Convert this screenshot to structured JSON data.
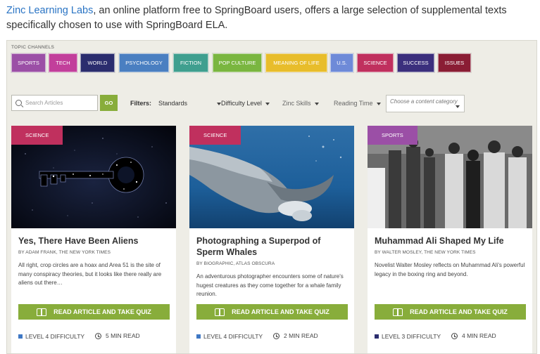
{
  "intro": {
    "link_text": "Zinc Learning Labs",
    "rest_text": ", an online platform free to SpringBoard users, offers a large selection of supplemental texts specifically chosen to use with SpringBoard ELA."
  },
  "channels": {
    "label": "TOPIC CHANNELS",
    "items": [
      {
        "label": "SPORTS",
        "color": "#9b4fa6"
      },
      {
        "label": "TECH",
        "color": "#c23f9b"
      },
      {
        "label": "WORLD",
        "color": "#2b2d6e"
      },
      {
        "label": "PSYCHOLOGY",
        "color": "#4a7fc1"
      },
      {
        "label": "FICTION",
        "color": "#3f9f8f"
      },
      {
        "label": "POP CULTURE",
        "color": "#7ab640"
      },
      {
        "label": "MEANING OF LIFE",
        "color": "#e8bd2b"
      },
      {
        "label": "U.S.",
        "color": "#6e8ad8"
      },
      {
        "label": "SCIENCE",
        "color": "#c0305e"
      },
      {
        "label": "SUCCESS",
        "color": "#3b2f7d"
      },
      {
        "label": "ISSUES",
        "color": "#8a1d34"
      }
    ]
  },
  "search": {
    "placeholder": "Search Articles",
    "go_label": "GO"
  },
  "filters": {
    "label": "Filters:",
    "standards": "Standards",
    "difficulty": "Difficulty Level",
    "skills": "Zinc Skills",
    "reading_time": "Reading Time",
    "category_placeholder": "Choose a content category"
  },
  "cards": [
    {
      "tag": "SCIENCE",
      "tag_color": "#c0305e",
      "title": "Yes, There Have Been Aliens",
      "byline": "BY ADAM FRANK, THE NEW YORK TIMES",
      "description": "All right, crop circles are a hoax and Area 51 is the site of many conspiracy theories, but it looks like there really are aliens out there…",
      "quiz_label": "READ ARTICLE AND TAKE QUIZ",
      "level": "LEVEL 4 DIFFICULTY",
      "level_color": "#3f78c4",
      "time": "5 MIN READ"
    },
    {
      "tag": "SCIENCE",
      "tag_color": "#c0305e",
      "title": "Photographing a Superpod of Sperm Whales",
      "byline": "BY BIOGRAPHIC, ATLAS OBSCURA",
      "description": "An adventurous photographer encounters some of nature's hugest creatures as they come together for a whale family reunion.",
      "quiz_label": "READ ARTICLE AND TAKE QUIZ",
      "level": "LEVEL 4 DIFFICULTY",
      "level_color": "#3f78c4",
      "time": "2 MIN READ"
    },
    {
      "tag": "SPORTS",
      "tag_color": "#9b4fa6",
      "title": "Muhammad Ali Shaped My Life",
      "byline": "BY WALTER MOSLEY, THE NEW YORK TIMES",
      "description": "Novelist Walter Mosley reflects on Muhammad Ali's powerful legacy in the boxing ring and beyond.",
      "quiz_label": "READ ARTICLE AND TAKE QUIZ",
      "level": "LEVEL 3 DIFFICULTY",
      "level_color": "#2b2d6e",
      "time": "4 MIN READ"
    }
  ]
}
